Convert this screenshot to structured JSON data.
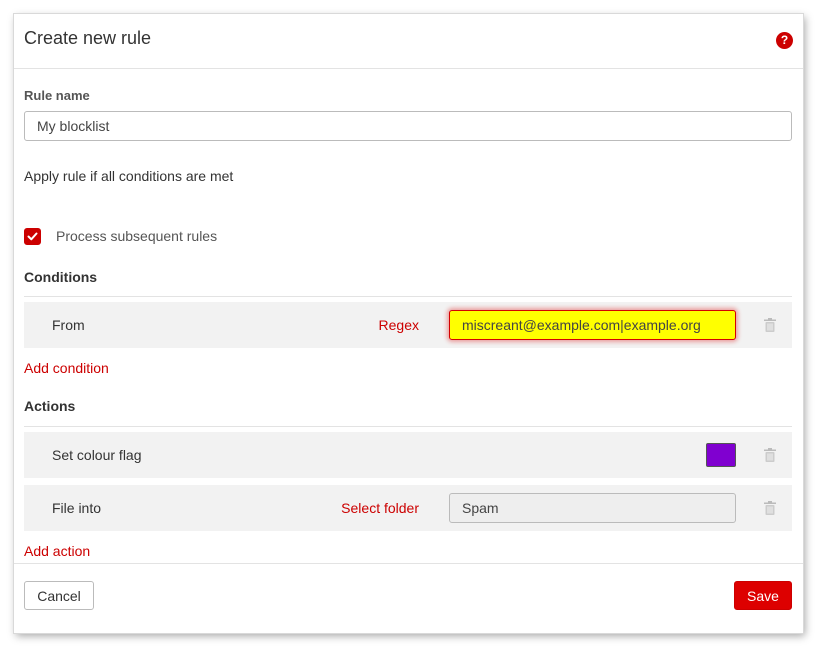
{
  "dialog": {
    "title": "Create new rule",
    "help_icon": "question-circle-icon"
  },
  "rule_name": {
    "label": "Rule name",
    "value": "My blocklist"
  },
  "apply_text": "Apply rule if all conditions are met",
  "process_subsequent": {
    "label": "Process subsequent rules",
    "checked": true
  },
  "conditions": {
    "title": "Conditions",
    "items": [
      {
        "field": "From",
        "mode": "Regex",
        "value": "miscreant@example.com|example.org"
      }
    ],
    "add_label": "Add condition"
  },
  "actions": {
    "title": "Actions",
    "items": [
      {
        "label": "Set colour flag",
        "color": "#8000d0"
      },
      {
        "label": "File into",
        "link": "Select folder",
        "value": "Spam"
      }
    ],
    "add_label": "Add action"
  },
  "footer": {
    "cancel_label": "Cancel",
    "save_label": "Save"
  },
  "colors": {
    "accent": "#cc0000",
    "highlight": "#ffff00"
  }
}
